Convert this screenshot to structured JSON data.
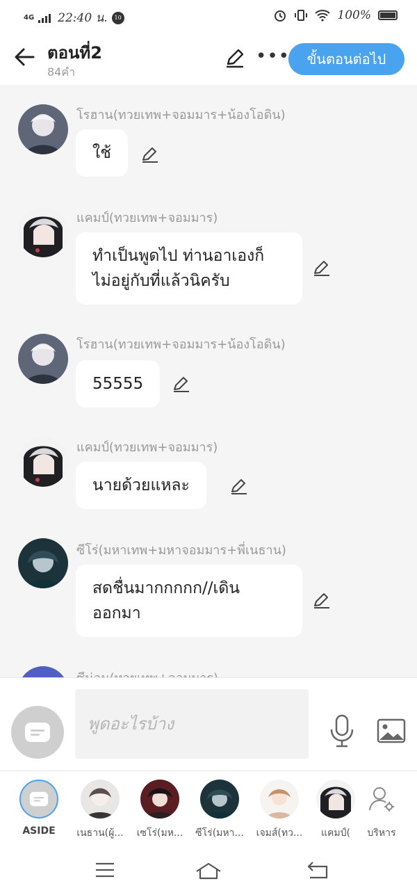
{
  "status_bar": {
    "network": "4G",
    "time": "22:40 น.",
    "notification_badge": "10",
    "battery": "100%"
  },
  "header": {
    "title": "ตอนที่2",
    "subtitle": "84คำ",
    "next_button": "ขั้นตอนต่อไป"
  },
  "messages": [
    {
      "name": "โรฮาน(ทวยเทพ+จอมมาร+น้องโอดิน)",
      "text": "ใช้",
      "avatar_color": "#6d7382"
    },
    {
      "name": "แคมป์(ทวยเทพ+จอมมาร)",
      "text": "ทำเป็นพูดไป ท่านอาเองก็\nไม่อยู่กับที่แล้วนิครับ",
      "avatar_color": "#2a2a2e"
    },
    {
      "name": "โรฮาน(ทวยเทพ+จอมมาร+น้องโอดิน)",
      "text": "55555",
      "avatar_color": "#6d7382"
    },
    {
      "name": "แคมป์(ทวยเทพ+จอมมาร)",
      "text": "นายด้วยแหละ",
      "avatar_color": "#2a2a2e"
    },
    {
      "name": "ซีโร่(มหาเทพ+มหาจอมมาร+พี่เนธาน)",
      "text": "สดชื่นมากกกกก//เดิน\nออกมา",
      "avatar_color": "#1f3a44"
    },
    {
      "name": "ซีน่อน(ทวยเทพ+จอมมาร)",
      "text": "",
      "avatar_color": "#4f5fc4"
    }
  ],
  "input": {
    "placeholder": "พูดอะไรบ้าง"
  },
  "characters": [
    {
      "label": "ASIDE"
    },
    {
      "label": "เนธาน(ผู้..."
    },
    {
      "label": "เซโร่(มห..."
    },
    {
      "label": "ซีโร่(มหา..."
    },
    {
      "label": "เจมส์(ทว..."
    },
    {
      "label": "แคมป์("
    },
    {
      "label": "บริหาร"
    }
  ],
  "icons": {
    "back": "arrow-left-icon",
    "edit": "pencil-icon",
    "more": "more-dots-icon",
    "mic": "microphone-icon",
    "image": "image-icon",
    "menu": "menu-icon",
    "home": "home-icon",
    "return": "return-icon",
    "manage": "user-settings-icon"
  },
  "colors": {
    "accent": "#4aa3ef",
    "background": "#f5f5f5",
    "bubble": "#ffffff",
    "name_text": "#999999"
  }
}
